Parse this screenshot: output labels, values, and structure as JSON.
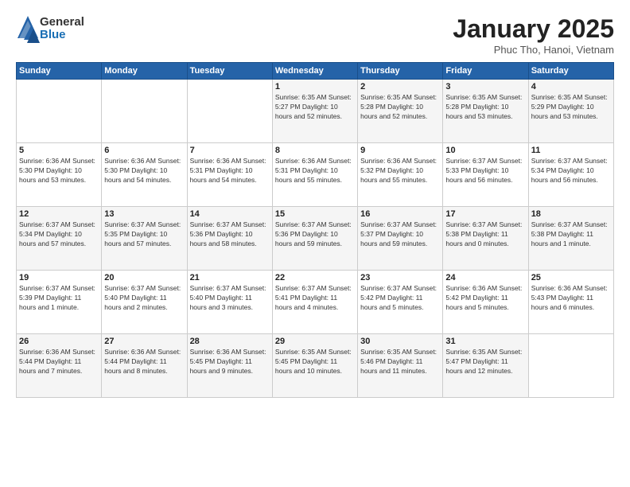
{
  "header": {
    "logo": {
      "general": "General",
      "blue": "Blue"
    },
    "title": "January 2025",
    "location": "Phuc Tho, Hanoi, Vietnam"
  },
  "weekdays": [
    "Sunday",
    "Monday",
    "Tuesday",
    "Wednesday",
    "Thursday",
    "Friday",
    "Saturday"
  ],
  "weeks": [
    [
      {
        "day": "",
        "info": ""
      },
      {
        "day": "",
        "info": ""
      },
      {
        "day": "",
        "info": ""
      },
      {
        "day": "1",
        "info": "Sunrise: 6:35 AM\nSunset: 5:27 PM\nDaylight: 10 hours\nand 52 minutes."
      },
      {
        "day": "2",
        "info": "Sunrise: 6:35 AM\nSunset: 5:28 PM\nDaylight: 10 hours\nand 52 minutes."
      },
      {
        "day": "3",
        "info": "Sunrise: 6:35 AM\nSunset: 5:28 PM\nDaylight: 10 hours\nand 53 minutes."
      },
      {
        "day": "4",
        "info": "Sunrise: 6:35 AM\nSunset: 5:29 PM\nDaylight: 10 hours\nand 53 minutes."
      }
    ],
    [
      {
        "day": "5",
        "info": "Sunrise: 6:36 AM\nSunset: 5:30 PM\nDaylight: 10 hours\nand 53 minutes."
      },
      {
        "day": "6",
        "info": "Sunrise: 6:36 AM\nSunset: 5:30 PM\nDaylight: 10 hours\nand 54 minutes."
      },
      {
        "day": "7",
        "info": "Sunrise: 6:36 AM\nSunset: 5:31 PM\nDaylight: 10 hours\nand 54 minutes."
      },
      {
        "day": "8",
        "info": "Sunrise: 6:36 AM\nSunset: 5:31 PM\nDaylight: 10 hours\nand 55 minutes."
      },
      {
        "day": "9",
        "info": "Sunrise: 6:36 AM\nSunset: 5:32 PM\nDaylight: 10 hours\nand 55 minutes."
      },
      {
        "day": "10",
        "info": "Sunrise: 6:37 AM\nSunset: 5:33 PM\nDaylight: 10 hours\nand 56 minutes."
      },
      {
        "day": "11",
        "info": "Sunrise: 6:37 AM\nSunset: 5:34 PM\nDaylight: 10 hours\nand 56 minutes."
      }
    ],
    [
      {
        "day": "12",
        "info": "Sunrise: 6:37 AM\nSunset: 5:34 PM\nDaylight: 10 hours\nand 57 minutes."
      },
      {
        "day": "13",
        "info": "Sunrise: 6:37 AM\nSunset: 5:35 PM\nDaylight: 10 hours\nand 57 minutes."
      },
      {
        "day": "14",
        "info": "Sunrise: 6:37 AM\nSunset: 5:36 PM\nDaylight: 10 hours\nand 58 minutes."
      },
      {
        "day": "15",
        "info": "Sunrise: 6:37 AM\nSunset: 5:36 PM\nDaylight: 10 hours\nand 59 minutes."
      },
      {
        "day": "16",
        "info": "Sunrise: 6:37 AM\nSunset: 5:37 PM\nDaylight: 10 hours\nand 59 minutes."
      },
      {
        "day": "17",
        "info": "Sunrise: 6:37 AM\nSunset: 5:38 PM\nDaylight: 11 hours\nand 0 minutes."
      },
      {
        "day": "18",
        "info": "Sunrise: 6:37 AM\nSunset: 5:38 PM\nDaylight: 11 hours\nand 1 minute."
      }
    ],
    [
      {
        "day": "19",
        "info": "Sunrise: 6:37 AM\nSunset: 5:39 PM\nDaylight: 11 hours\nand 1 minute."
      },
      {
        "day": "20",
        "info": "Sunrise: 6:37 AM\nSunset: 5:40 PM\nDaylight: 11 hours\nand 2 minutes."
      },
      {
        "day": "21",
        "info": "Sunrise: 6:37 AM\nSunset: 5:40 PM\nDaylight: 11 hours\nand 3 minutes."
      },
      {
        "day": "22",
        "info": "Sunrise: 6:37 AM\nSunset: 5:41 PM\nDaylight: 11 hours\nand 4 minutes."
      },
      {
        "day": "23",
        "info": "Sunrise: 6:37 AM\nSunset: 5:42 PM\nDaylight: 11 hours\nand 5 minutes."
      },
      {
        "day": "24",
        "info": "Sunrise: 6:36 AM\nSunset: 5:42 PM\nDaylight: 11 hours\nand 5 minutes."
      },
      {
        "day": "25",
        "info": "Sunrise: 6:36 AM\nSunset: 5:43 PM\nDaylight: 11 hours\nand 6 minutes."
      }
    ],
    [
      {
        "day": "26",
        "info": "Sunrise: 6:36 AM\nSunset: 5:44 PM\nDaylight: 11 hours\nand 7 minutes."
      },
      {
        "day": "27",
        "info": "Sunrise: 6:36 AM\nSunset: 5:44 PM\nDaylight: 11 hours\nand 8 minutes."
      },
      {
        "day": "28",
        "info": "Sunrise: 6:36 AM\nSunset: 5:45 PM\nDaylight: 11 hours\nand 9 minutes."
      },
      {
        "day": "29",
        "info": "Sunrise: 6:35 AM\nSunset: 5:45 PM\nDaylight: 11 hours\nand 10 minutes."
      },
      {
        "day": "30",
        "info": "Sunrise: 6:35 AM\nSunset: 5:46 PM\nDaylight: 11 hours\nand 11 minutes."
      },
      {
        "day": "31",
        "info": "Sunrise: 6:35 AM\nSunset: 5:47 PM\nDaylight: 11 hours\nand 12 minutes."
      },
      {
        "day": "",
        "info": ""
      }
    ]
  ]
}
